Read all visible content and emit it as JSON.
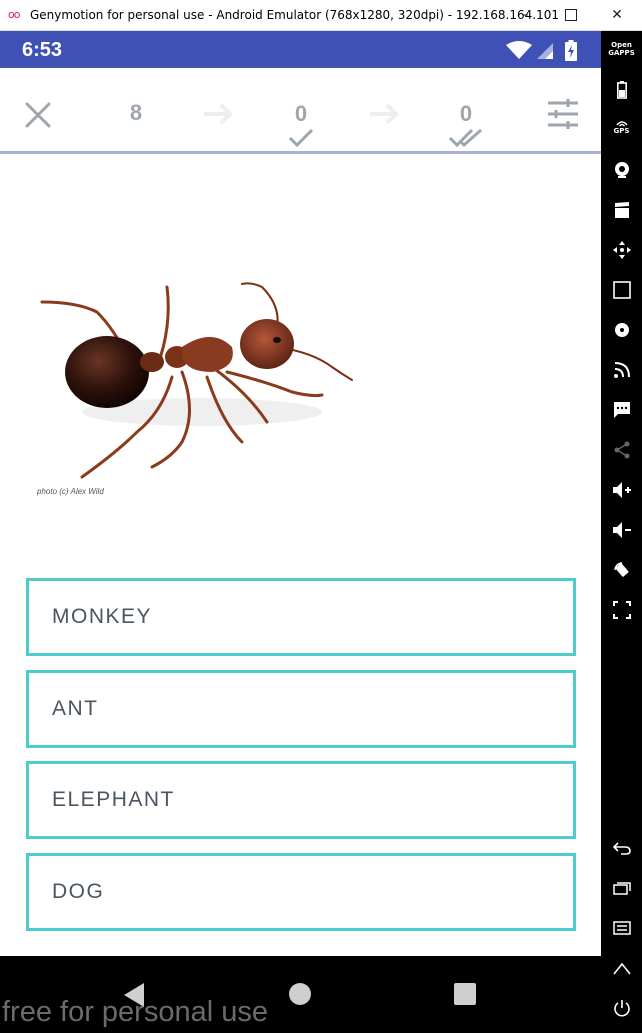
{
  "window": {
    "title": "Genymotion for personal use - Android Emulator (768x1280, 320dpi) - 192.168.164.101",
    "minimize": "–",
    "close": "✕"
  },
  "statusbar": {
    "time": "6:53"
  },
  "toolbar": {
    "total_count": "8",
    "learned_count": "0",
    "mastered_count": "0"
  },
  "question": {
    "photo_credit": "photo (c) Alex Wild"
  },
  "answers": [
    {
      "label": "MONKEY"
    },
    {
      "label": "ANT"
    },
    {
      "label": "ELEPHANT"
    },
    {
      "label": "DOG"
    }
  ],
  "watermark": "free for personal use",
  "sidepanel": {
    "opengapps": "Open GAPPS",
    "gps": "GPS",
    "id": "ID",
    "ratio": "1:1"
  },
  "colors": {
    "statusbar": "#3f51b5",
    "answer_border": "#4ecbcb",
    "toolbar_divider": "#a9b1d6"
  }
}
